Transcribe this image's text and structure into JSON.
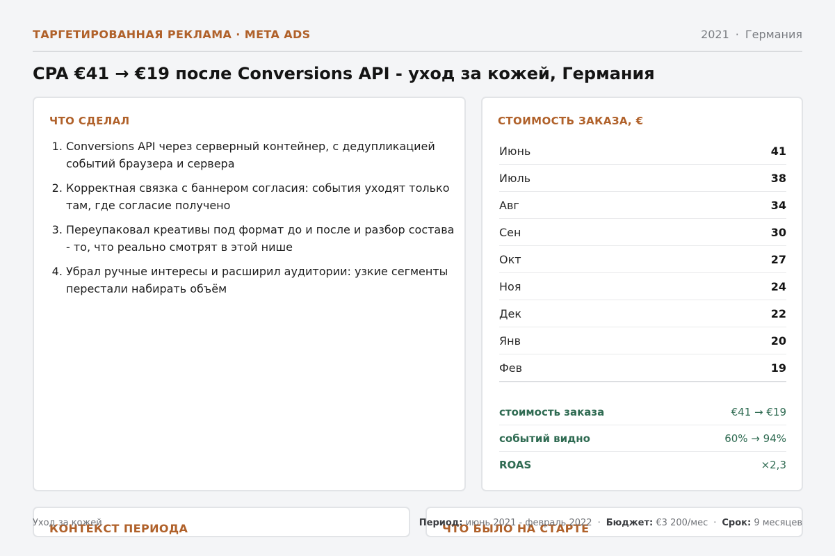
{
  "header": {
    "kicker": "ТАРГЕТИРОВАННАЯ РЕКЛАМА · META ADS",
    "year": "2021",
    "country": "Германия",
    "title": "CPA €41 → €19 после Conversions API - уход за кожей, Германия"
  },
  "actions": {
    "heading": "ЧТО СДЕЛАЛ",
    "items": [
      "Conversions API через серверный контейнер, с дедупликацией событий браузера и сервера",
      "Корректная связка с баннером согласия: события уходят только там, где согласие получено",
      "Переупаковал креативы под формат до и после и разбор состава - то, что реально смотрят в этой нише",
      "Убрал ручные интересы и расширил аудитории: узкие сегменты перестали набирать объём"
    ]
  },
  "cost": {
    "heading": "СТОИМОСТЬ ЗАКАЗА, €",
    "months": [
      {
        "label": "Июнь",
        "value": "41"
      },
      {
        "label": "Июль",
        "value": "38"
      },
      {
        "label": "Авг",
        "value": "34"
      },
      {
        "label": "Сен",
        "value": "30"
      },
      {
        "label": "Окт",
        "value": "27"
      },
      {
        "label": "Ноя",
        "value": "24"
      },
      {
        "label": "Дек",
        "value": "22"
      },
      {
        "label": "Янв",
        "value": "20"
      },
      {
        "label": "Фев",
        "value": "19"
      }
    ],
    "stats": [
      {
        "label": "стоимость заказа",
        "value": "€41 → €19"
      },
      {
        "label": "событий видно",
        "value": "60% → 94%"
      },
      {
        "label": "ROAS",
        "value": "×2,3"
      }
    ]
  },
  "bottom": {
    "context_heading": "КОНТЕКСТ ПЕРИОДА",
    "start_heading": "ЧТО БЫЛО НА СТАРТЕ"
  },
  "footer": {
    "niche": "Уход за кожей",
    "period_label": "Период:",
    "period_value": "июнь 2021 - февраль 2022",
    "budget_label": "Бюджет:",
    "budget_value": "€3 200/мес",
    "term_label": "Срок:",
    "term_value": "9 месяцев"
  },
  "colors": {
    "accent": "#b0612a",
    "positive": "#2f6b52"
  }
}
